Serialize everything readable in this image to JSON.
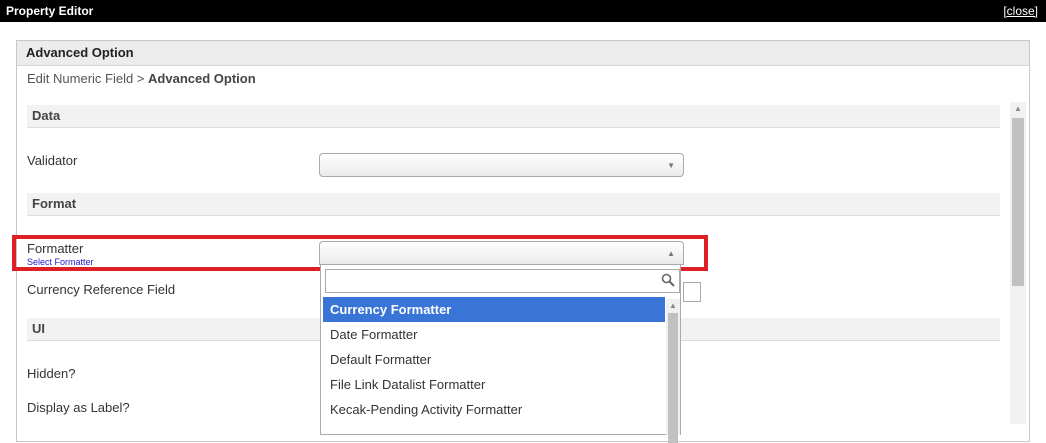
{
  "window": {
    "title": "Property Editor",
    "close_label": "[close]"
  },
  "panel": {
    "title": "Advanced Option",
    "breadcrumb_parent": "Edit Numeric Field >",
    "breadcrumb_current": "Advanced Option"
  },
  "sections": {
    "data": "Data",
    "format": "Format",
    "ui": "UI"
  },
  "fields": {
    "validator": {
      "label": "Validator",
      "value": ""
    },
    "formatter": {
      "label": "Formatter",
      "sublabel": "Select Formatter",
      "value": ""
    },
    "currency_reference_field": {
      "label": "Currency Reference Field"
    },
    "hidden": {
      "label": "Hidden?"
    },
    "display_as_label": {
      "label": "Display as Label?"
    }
  },
  "dropdown": {
    "search_value": "",
    "options": [
      "Currency Formatter",
      "Date Formatter",
      "Default Formatter",
      "File Link Datalist Formatter",
      "Kecak-Pending Activity Formatter"
    ],
    "selected_index": 0
  },
  "colors": {
    "highlight_border": "#dd1f26",
    "selected_option": "#3875d7",
    "sublabel": "#2020c8"
  }
}
